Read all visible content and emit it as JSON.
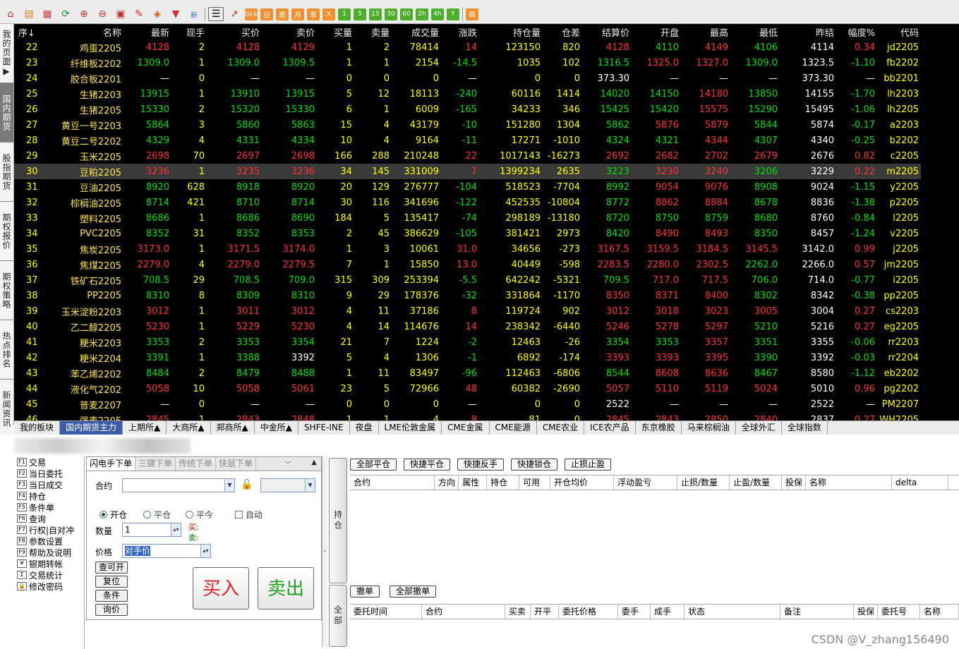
{
  "toolbar": {
    "buttons": [
      "home-icon",
      "book-icon",
      "chart-icon",
      "refresh-icon",
      "zoom-in-icon",
      "zoom-out-icon",
      "window-icon",
      "pen-icon",
      "layers-icon",
      "filter-icon"
    ],
    "new_label": "新",
    "period_labels": [
      "tick",
      "日",
      "周",
      "月",
      "季",
      "X",
      "1",
      "5",
      "15",
      "30",
      "60",
      "2h",
      "4h",
      "Y"
    ]
  },
  "side_tabs": [
    {
      "label": "我的页面▶",
      "active": false
    },
    {
      "label": "国内期货",
      "active": true
    },
    {
      "label": "股指期货",
      "active": false
    },
    {
      "label": "期权报价",
      "active": false
    },
    {
      "label": "期权策略",
      "active": false
    },
    {
      "label": "热点排名",
      "active": false
    },
    {
      "label": "新闻资讯",
      "active": false
    }
  ],
  "grid": {
    "columns": [
      "序↓",
      "名称",
      "最新",
      "现手",
      "买价",
      "卖价",
      "买量",
      "卖量",
      "成交量",
      "涨跌",
      "持仓量",
      "仓差",
      "结算价",
      "开盘",
      "最高",
      "最低",
      "昨结",
      "幅度%",
      "代码"
    ],
    "selected_index": 8,
    "rows": [
      [
        "22",
        "鸡蛋2205",
        "4128",
        "2",
        "4128",
        "4129",
        "1",
        "2",
        "78414",
        "14",
        "123150",
        "820",
        "4128",
        "4110",
        "4149",
        "4106",
        "4114",
        "0.34",
        "jd2205",
        "r"
      ],
      [
        "23",
        "纤维板2202",
        "1309.0",
        "1",
        "1309.0",
        "1309.5",
        "1",
        "1",
        "2154",
        "-14.5",
        "1035",
        "102",
        "1316.5",
        "1325.0",
        "1327.0",
        "1309.0",
        "1323.5",
        "-1.10",
        "fb2202",
        "g"
      ],
      [
        "24",
        "胶合板2201",
        "—",
        "0",
        "—",
        "—",
        "0",
        "0",
        "0",
        "—",
        "0",
        "0",
        "373.30",
        "—",
        "—",
        "—",
        "373.30",
        "—",
        "bb2201",
        "w"
      ],
      [
        "25",
        "生猪2203",
        "13915",
        "1",
        "13910",
        "13915",
        "5",
        "12",
        "18113",
        "-240",
        "60116",
        "1414",
        "14020",
        "14150",
        "14180",
        "13850",
        "14155",
        "-1.70",
        "lh2203",
        "g"
      ],
      [
        "26",
        "生猪2205",
        "15330",
        "2",
        "15320",
        "15330",
        "6",
        "1",
        "6009",
        "-165",
        "34233",
        "346",
        "15425",
        "15420",
        "15575",
        "15290",
        "15495",
        "-1.06",
        "lh2205",
        "g"
      ],
      [
        "27",
        "黄豆一号2203",
        "5864",
        "3",
        "5860",
        "5863",
        "15",
        "4",
        "43179",
        "-10",
        "151280",
        "1304",
        "5862",
        "5876",
        "5879",
        "5844",
        "5874",
        "-0.17",
        "a2203",
        "g"
      ],
      [
        "28",
        "黄豆二号2202",
        "4329",
        "4",
        "4331",
        "4334",
        "10",
        "4",
        "9164",
        "-11",
        "17271",
        "-1010",
        "4324",
        "4321",
        "4344",
        "4307",
        "4340",
        "-0.25",
        "b2202",
        "g"
      ],
      [
        "29",
        "玉米2205",
        "2698",
        "70",
        "2697",
        "2698",
        "166",
        "288",
        "210248",
        "22",
        "1017143",
        "-16273",
        "2692",
        "2682",
        "2702",
        "2679",
        "2676",
        "0.82",
        "c2205",
        "r"
      ],
      [
        "30",
        "豆粕2205",
        "3236",
        "1",
        "3235",
        "3236",
        "34",
        "145",
        "331009",
        "7",
        "1399234",
        "2635",
        "3223",
        "3230",
        "3240",
        "3206",
        "3229",
        "0.22",
        "m2205",
        "r"
      ],
      [
        "31",
        "豆油2205",
        "8920",
        "628",
        "8918",
        "8920",
        "20",
        "129",
        "276777",
        "-104",
        "518523",
        "-7704",
        "8992",
        "9054",
        "9076",
        "8908",
        "9024",
        "-1.15",
        "y2205",
        "g"
      ],
      [
        "32",
        "棕榈油2205",
        "8714",
        "421",
        "8710",
        "8714",
        "30",
        "116",
        "341696",
        "-122",
        "452535",
        "-10804",
        "8772",
        "8862",
        "8884",
        "8678",
        "8836",
        "-1.38",
        "p2205",
        "g"
      ],
      [
        "33",
        "塑料2205",
        "8686",
        "1",
        "8686",
        "8690",
        "184",
        "5",
        "135417",
        "-74",
        "298189",
        "-13180",
        "8720",
        "8750",
        "8759",
        "8680",
        "8760",
        "-0.84",
        "l2205",
        "g"
      ],
      [
        "34",
        "PVC2205",
        "8352",
        "31",
        "8352",
        "8353",
        "2",
        "45",
        "386629",
        "-105",
        "381421",
        "2973",
        "8420",
        "8490",
        "8493",
        "8350",
        "8457",
        "-1.24",
        "v2205",
        "g"
      ],
      [
        "35",
        "焦炭2205",
        "3173.0",
        "1",
        "3171.5",
        "3174.0",
        "1",
        "3",
        "10061",
        "31.0",
        "34656",
        "-273",
        "3167.5",
        "3159.5",
        "3184.5",
        "3145.5",
        "3142.0",
        "0.99",
        "j2205",
        "r"
      ],
      [
        "36",
        "焦煤2205",
        "2279.0",
        "4",
        "2279.0",
        "2279.5",
        "7",
        "1",
        "15850",
        "13.0",
        "40449",
        "-598",
        "2283.5",
        "2280.0",
        "2302.5",
        "2262.0",
        "2266.0",
        "0.57",
        "jm2205",
        "r"
      ],
      [
        "37",
        "铁矿石2205",
        "708.5",
        "29",
        "708.5",
        "709.0",
        "315",
        "309",
        "253394",
        "-5.5",
        "642242",
        "-5321",
        "709.5",
        "717.0",
        "717.5",
        "706.0",
        "714.0",
        "-0.77",
        "i2205",
        "g"
      ],
      [
        "38",
        "PP2205",
        "8310",
        "8",
        "8309",
        "8310",
        "9",
        "29",
        "178376",
        "-32",
        "331864",
        "-1170",
        "8350",
        "8371",
        "8400",
        "8302",
        "8342",
        "-0.38",
        "pp2205",
        "g"
      ],
      [
        "39",
        "玉米淀粉2203",
        "3012",
        "1",
        "3011",
        "3012",
        "4",
        "11",
        "37186",
        "8",
        "119724",
        "902",
        "3012",
        "3018",
        "3023",
        "3005",
        "3004",
        "0.27",
        "cs2203",
        "r"
      ],
      [
        "40",
        "乙二醇2205",
        "5230",
        "1",
        "5229",
        "5230",
        "4",
        "14",
        "114676",
        "14",
        "238342",
        "-6440",
        "5246",
        "5278",
        "5297",
        "5210",
        "5216",
        "0.27",
        "eg2205",
        "r"
      ],
      [
        "41",
        "粳米2203",
        "3353",
        "2",
        "3353",
        "3354",
        "21",
        "7",
        "1224",
        "-2",
        "12463",
        "-26",
        "3354",
        "3353",
        "3357",
        "3351",
        "3355",
        "-0.06",
        "rr2203",
        "g"
      ],
      [
        "42",
        "粳米2204",
        "3391",
        "1",
        "3388",
        "3392",
        "5",
        "4",
        "1306",
        "-1",
        "6892",
        "-174",
        "3393",
        "3393",
        "3395",
        "3390",
        "3392",
        "-0.03",
        "rr2204",
        "g"
      ],
      [
        "43",
        "苯乙烯2202",
        "8484",
        "2",
        "8479",
        "8488",
        "1",
        "11",
        "83497",
        "-96",
        "112463",
        "-6806",
        "8544",
        "8608",
        "8636",
        "8467",
        "8580",
        "-1.12",
        "eb2202",
        "g"
      ],
      [
        "44",
        "液化气2202",
        "5058",
        "10",
        "5058",
        "5061",
        "23",
        "5",
        "72966",
        "48",
        "60382",
        "-2690",
        "5057",
        "5110",
        "5119",
        "5024",
        "5010",
        "0.96",
        "pg2202",
        "r"
      ],
      [
        "45",
        "普麦2207",
        "—",
        "0",
        "—",
        "—",
        "0",
        "0",
        "0",
        "—",
        "0",
        "0",
        "2522",
        "—",
        "—",
        "—",
        "2522",
        "—",
        "PM2207",
        "w"
      ],
      [
        "46",
        "强麦2205",
        "2845",
        "1",
        "2843",
        "2848",
        "1",
        "1",
        "4",
        "8",
        "81",
        "0",
        "2845",
        "2843",
        "2850",
        "2840",
        "2837",
        "0.27",
        "WH2205",
        "r"
      ]
    ]
  },
  "bottom_tabs": [
    "我的板块",
    "国内期货主力",
    "上期所▲",
    "大商所▲",
    "郑商所▲",
    "中金所▲",
    "SHFE-INE",
    "夜盘",
    "LME伦敦金属",
    "CME金属",
    "CME能源",
    "CME农业",
    "ICE农产品",
    "东京橡胶",
    "马来棕榈油",
    "全球外汇",
    "全球指数"
  ],
  "nav": [
    {
      "key": "F1",
      "label": "交易"
    },
    {
      "key": "F2",
      "label": "当日委托"
    },
    {
      "key": "F3",
      "label": "当日成交"
    },
    {
      "key": "F4",
      "label": "持仓"
    },
    {
      "key": "F5",
      "label": "条件单"
    },
    {
      "key": "F6",
      "label": "查询"
    },
    {
      "key": "F7",
      "label": "行权|自对冲"
    },
    {
      "key": "F8",
      "label": "参数设置"
    },
    {
      "key": "F9",
      "label": "帮助及说明"
    },
    {
      "key": "¥",
      "label": "银期转帐"
    },
    {
      "key": "Σ",
      "label": "交易统计"
    },
    {
      "key": "🔒",
      "label": "修改密码"
    }
  ],
  "order": {
    "tabs": [
      "闪电手下单",
      "三键下单",
      "传统下单",
      "快鼠下单"
    ],
    "contract_label": "合约",
    "open_label": "开仓",
    "close_label": "平仓",
    "close_today_label": "平今",
    "auto_label": "自动",
    "qty_label": "数量",
    "qty_value": "1",
    "buy_hint": "买:",
    "sell_hint": "卖:",
    "price_label": "价格",
    "price_value": "对手价",
    "small_buttons": [
      "查可开",
      "复位",
      "条件",
      "询价"
    ],
    "buy_button": "买入",
    "sell_button": "卖出"
  },
  "positions": {
    "side_label": "持仓",
    "actions": [
      "全部平仓",
      "快捷平仓",
      "快捷反手",
      "快捷锁仓",
      "止损止盈"
    ],
    "columns": [
      "合约",
      "方向",
      "属性",
      "持仓",
      "可用",
      "开仓均价",
      "浮动盈亏",
      "止损/数量",
      "止盈/数量",
      "投保",
      "名称",
      "delta"
    ]
  },
  "orders": {
    "side_label": "全部",
    "actions": [
      "撤单",
      "全部撤单"
    ],
    "columns": [
      "委托时间",
      "合约",
      "买卖",
      "开平",
      "委托价格",
      "委手",
      "成手",
      "状态",
      "备注",
      "投保",
      "委托号",
      "名称"
    ]
  },
  "watermark": "CSDN @V_zhang156490",
  "colors": {
    "up": "#ff3232",
    "down": "#00e000",
    "name": "#ffe34f",
    "selected_tab": "#3b5ca8"
  }
}
